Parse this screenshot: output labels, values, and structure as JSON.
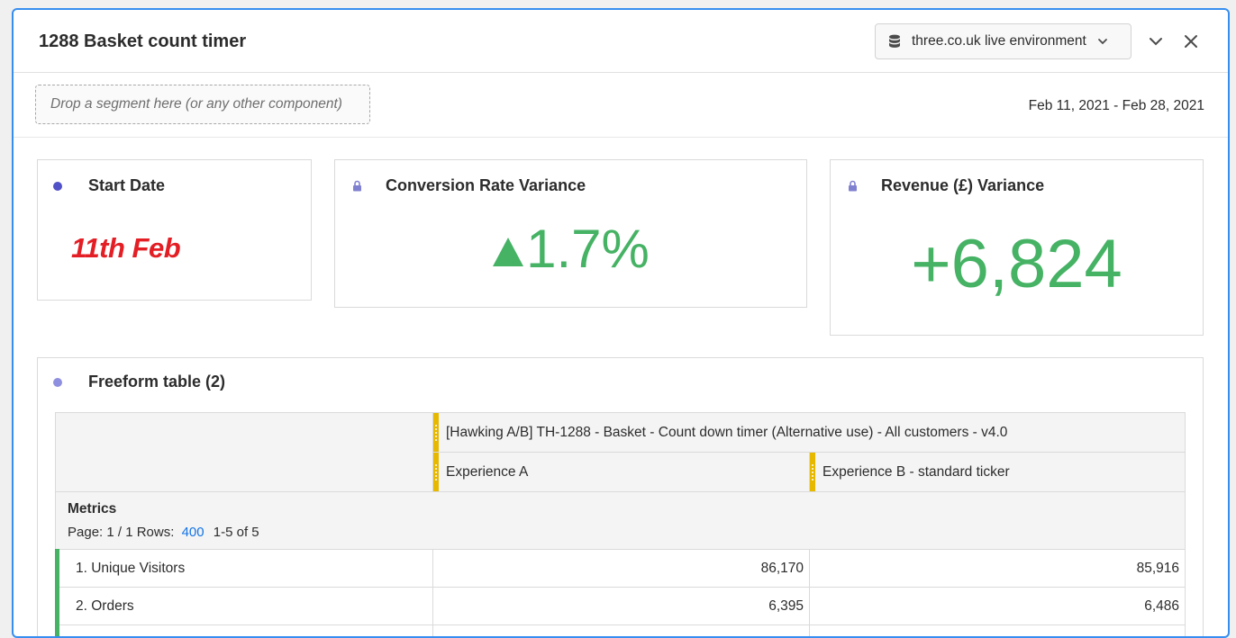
{
  "panel": {
    "title": "1288 Basket count timer",
    "report_suite": "three.co.uk live environment",
    "dropzone_placeholder": "Drop a segment here (or any other component)",
    "date_range": "Feb 11, 2021 - Feb 28, 2021"
  },
  "cards": {
    "start_date": {
      "title": "Start Date",
      "value": "11th Feb",
      "dot_color": "#5151c8"
    },
    "conversion": {
      "title": "Conversion Rate Variance",
      "value": "1.7%",
      "icon": "lock-icon"
    },
    "revenue": {
      "title": "Revenue (£) Variance",
      "value": "+6,824",
      "icon": "lock-icon"
    }
  },
  "freeform": {
    "title": "Freeform table (2)",
    "dot_color": "#8f8fe0",
    "dimension_header": "[Hawking A/B] TH-1288 - Basket - Count down timer (Alternative use) - All customers - v4.0",
    "columns": [
      "Experience A",
      "Experience B - standard ticker"
    ],
    "metrics_label": "Metrics",
    "page_text": "Page: 1 / 1 Rows:",
    "rows_value": "400",
    "range_text": "1-5 of 5",
    "rows": [
      {
        "label": "1. Unique Visitors",
        "values": [
          "86,170",
          "85,916"
        ]
      },
      {
        "label": "2. Orders",
        "values": [
          "6,395",
          "6,486"
        ]
      }
    ]
  },
  "colors": {
    "accent": "#378ef0",
    "positive": "#45b264",
    "highlight_red": "#e31e24",
    "dimension_grip": "#e6b800"
  }
}
